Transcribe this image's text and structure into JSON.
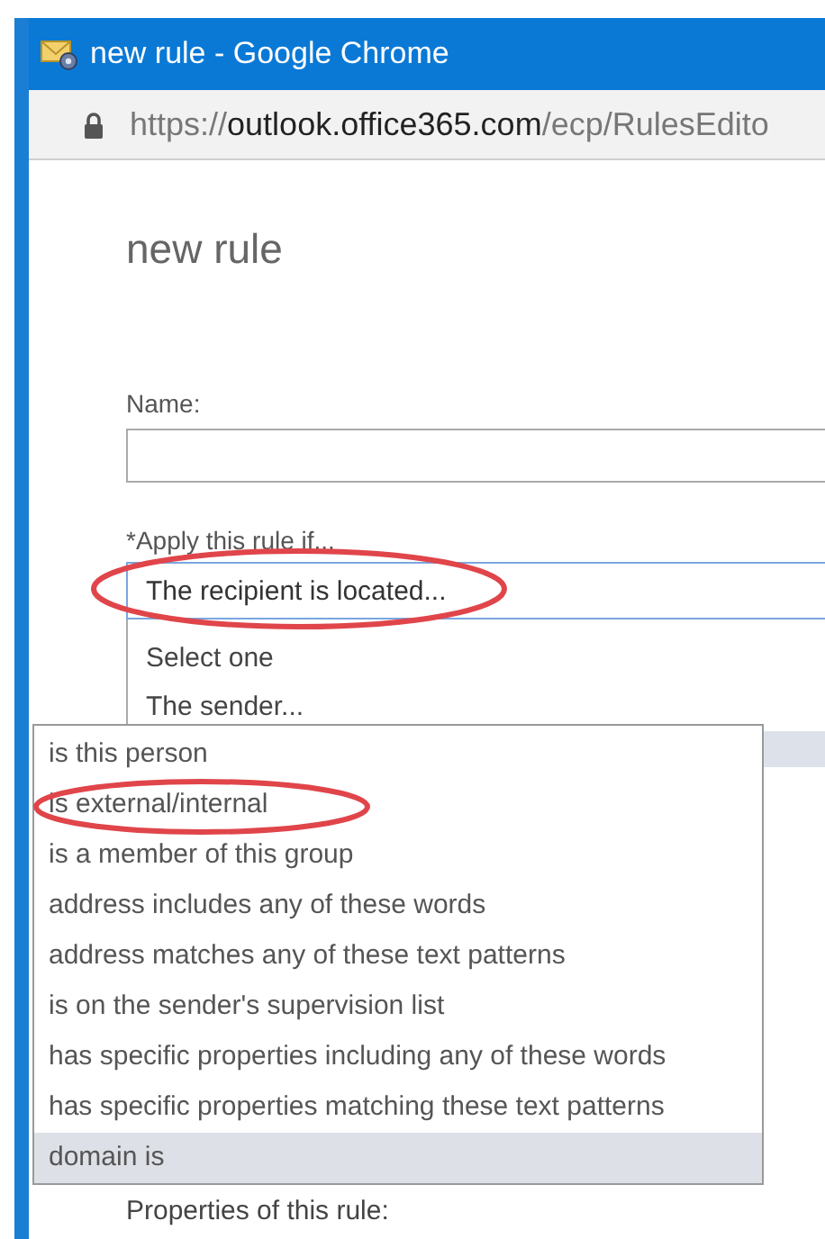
{
  "window": {
    "title": "new rule - Google Chrome"
  },
  "address_bar": {
    "url_scheme": "https://",
    "url_host": "outlook.office365.com",
    "url_path": "/ecp/RulesEdito"
  },
  "page": {
    "heading": "new rule",
    "name_label": "Name:",
    "condition_label": "*Apply this rule if...",
    "condition_value": "The recipient is located..."
  },
  "condition_list": [
    {
      "label": "Select one",
      "selected": false
    },
    {
      "label": "The sender...",
      "selected": false
    }
  ],
  "submenu": [
    {
      "label": "is this person",
      "selected": false,
      "circled": false
    },
    {
      "label": "is external/internal",
      "selected": false,
      "circled": true
    },
    {
      "label": "is a member of this group",
      "selected": false,
      "circled": false
    },
    {
      "label": "address includes any of these words",
      "selected": false,
      "circled": false
    },
    {
      "label": "address matches any of these text patterns",
      "selected": false,
      "circled": false
    },
    {
      "label": "is on the sender's supervision list",
      "selected": false,
      "circled": false
    },
    {
      "label": "has specific properties including any of these words",
      "selected": false,
      "circled": false
    },
    {
      "label": "has specific properties matching these text patterns",
      "selected": false,
      "circled": false
    },
    {
      "label": "domain is",
      "selected": true,
      "circled": false
    }
  ],
  "footer_label": "Properties of this rule:"
}
